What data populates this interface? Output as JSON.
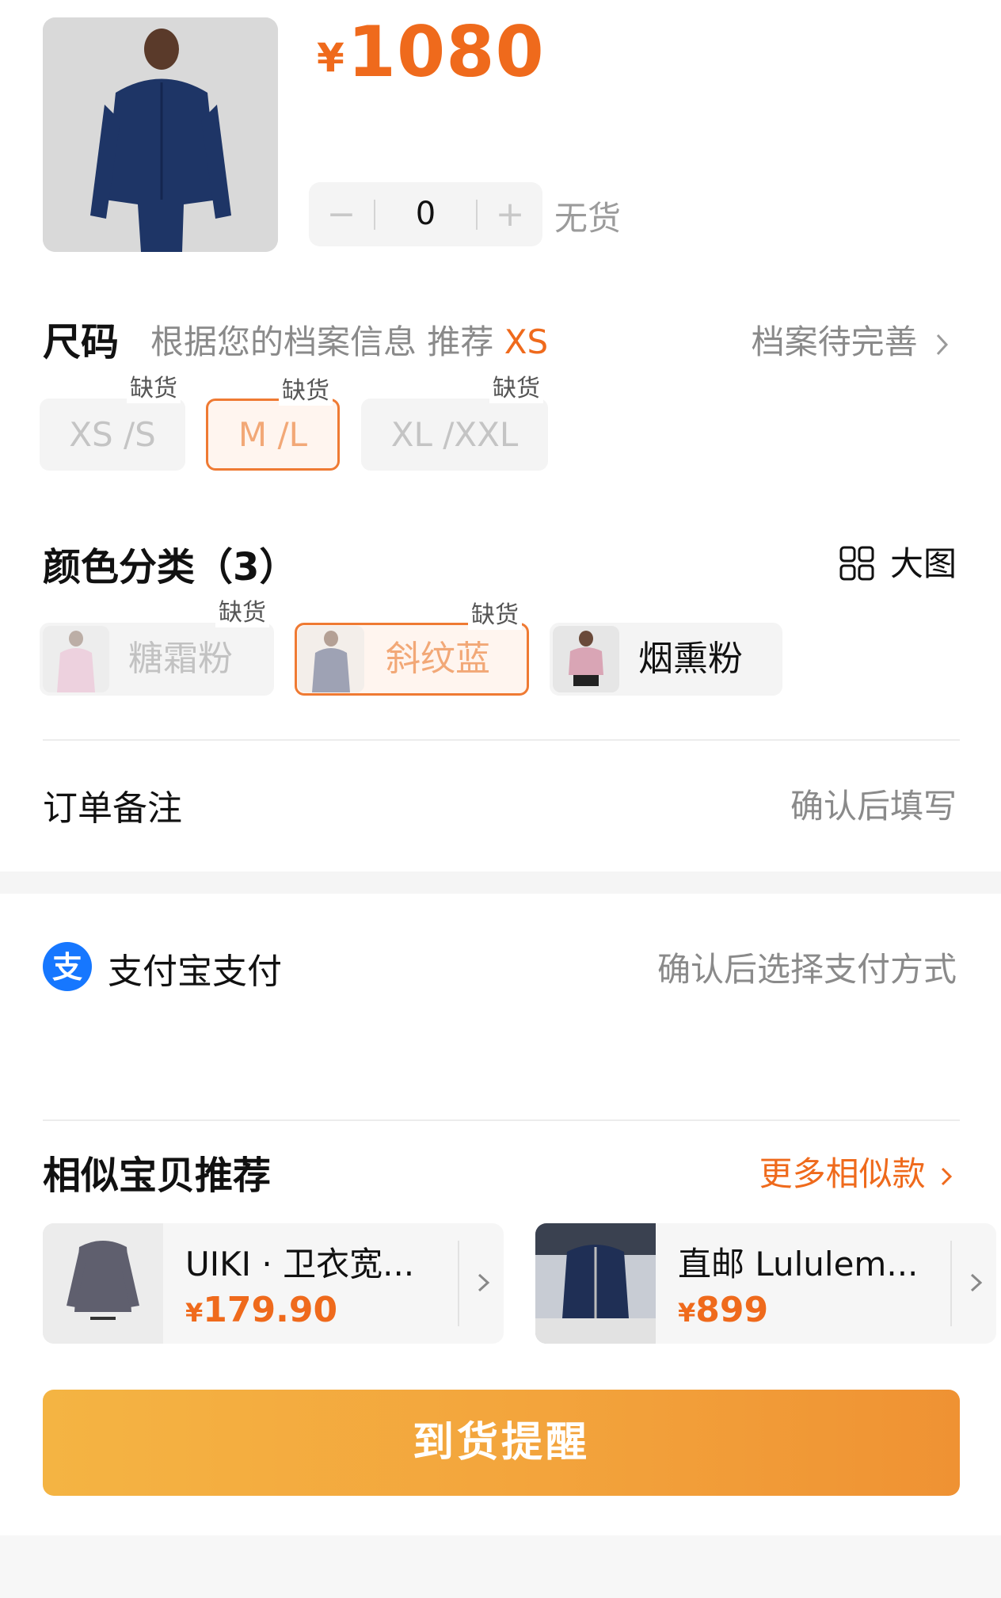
{
  "product": {
    "currency": "¥",
    "price": "1080",
    "quantity": "0",
    "minus": "−",
    "plus": "+",
    "stock_status": "无货"
  },
  "size": {
    "title": "尺码",
    "hint_prefix": "根据您的档案信息 推荐",
    "recommended": "XS",
    "profile_link": "档案待完善",
    "options": [
      {
        "label": "XS /S",
        "badge": "缺货"
      },
      {
        "label": "M /L",
        "badge": "缺货"
      },
      {
        "label": "XL /XXL",
        "badge": "缺货"
      }
    ]
  },
  "color": {
    "title": "颜色分类（3）",
    "big_view": "大图",
    "options": [
      {
        "label": "糖霜粉",
        "badge": "缺货"
      },
      {
        "label": "斜纹蓝",
        "badge": "缺货"
      },
      {
        "label": "烟熏粉",
        "badge": ""
      }
    ]
  },
  "order_note": {
    "label": "订单备注",
    "value": "确认后填写"
  },
  "payment": {
    "label": "支付宝支付",
    "value": "确认后选择支付方式"
  },
  "similar": {
    "title": "相似宝贝推荐",
    "more": "更多相似款",
    "items": [
      {
        "title": "UIKI · 卫衣宽...",
        "currency": "¥",
        "price": "179.90"
      },
      {
        "title": "直邮 Lululem...",
        "currency": "¥",
        "price": "899"
      }
    ]
  },
  "cta": {
    "label": "到货提醒"
  },
  "colors": {
    "accent": "#ef6a1c",
    "cta_start": "#f4b443",
    "cta_end": "#ef9233",
    "alipay_blue": "#1677ff"
  }
}
